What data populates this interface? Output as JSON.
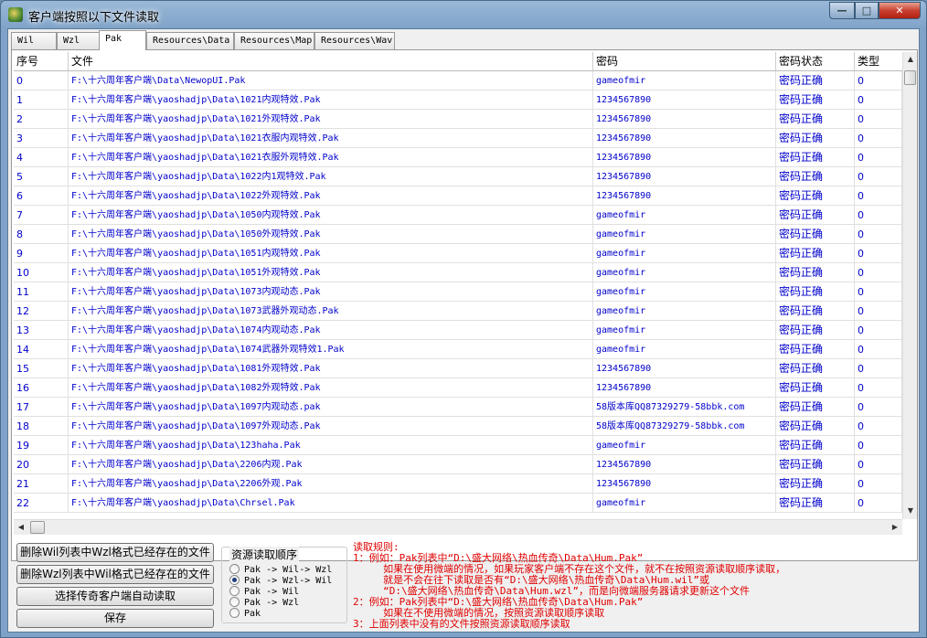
{
  "window": {
    "title": "客户端按照以下文件读取",
    "min": "—",
    "max": "□",
    "close": "✕"
  },
  "tabs": [
    "Wil",
    "Wzl",
    "Pak",
    "Resources\\Data",
    "Resources\\Map",
    "Resources\\Wav"
  ],
  "active_tab": "Pak",
  "columns": [
    "序号",
    "文件",
    "密码",
    "密码状态",
    "类型"
  ],
  "rows": [
    [
      "0",
      "F:\\十六周年客户端\\Data\\NewopUI.Pak",
      "gameofmir",
      "密码正确",
      "0"
    ],
    [
      "1",
      "F:\\十六周年客户端\\yaoshadjp\\Data\\1021内观特效.Pak",
      "1234567890",
      "密码正确",
      "0"
    ],
    [
      "2",
      "F:\\十六周年客户端\\yaoshadjp\\Data\\1021外观特效.Pak",
      "1234567890",
      "密码正确",
      "0"
    ],
    [
      "3",
      "F:\\十六周年客户端\\yaoshadjp\\Data\\1021衣服内观特效.Pak",
      "1234567890",
      "密码正确",
      "0"
    ],
    [
      "4",
      "F:\\十六周年客户端\\yaoshadjp\\Data\\1021衣服外观特效.Pak",
      "1234567890",
      "密码正确",
      "0"
    ],
    [
      "5",
      "F:\\十六周年客户端\\yaoshadjp\\Data\\1022内1观特效.Pak",
      "1234567890",
      "密码正确",
      "0"
    ],
    [
      "6",
      "F:\\十六周年客户端\\yaoshadjp\\Data\\1022外观特效.Pak",
      "1234567890",
      "密码正确",
      "0"
    ],
    [
      "7",
      "F:\\十六周年客户端\\yaoshadjp\\Data\\1050内观特效.Pak",
      "gameofmir",
      "密码正确",
      "0"
    ],
    [
      "8",
      "F:\\十六周年客户端\\yaoshadjp\\Data\\1050外观特效.Pak",
      "gameofmir",
      "密码正确",
      "0"
    ],
    [
      "9",
      "F:\\十六周年客户端\\yaoshadjp\\Data\\1051内观特效.Pak",
      "gameofmir",
      "密码正确",
      "0"
    ],
    [
      "10",
      "F:\\十六周年客户端\\yaoshadjp\\Data\\1051外观特效.Pak",
      "gameofmir",
      "密码正确",
      "0"
    ],
    [
      "11",
      "F:\\十六周年客户端\\yaoshadjp\\Data\\1073内观动态.Pak",
      "gameofmir",
      "密码正确",
      "0"
    ],
    [
      "12",
      "F:\\十六周年客户端\\yaoshadjp\\Data\\1073武器外观动态.Pak",
      "gameofmir",
      "密码正确",
      "0"
    ],
    [
      "13",
      "F:\\十六周年客户端\\yaoshadjp\\Data\\1074内观动态.Pak",
      "gameofmir",
      "密码正确",
      "0"
    ],
    [
      "14",
      "F:\\十六周年客户端\\yaoshadjp\\Data\\1074武器外观特效1.Pak",
      "gameofmir",
      "密码正确",
      "0"
    ],
    [
      "15",
      "F:\\十六周年客户端\\yaoshadjp\\Data\\1081外观特效.Pak",
      "1234567890",
      "密码正确",
      "0"
    ],
    [
      "16",
      "F:\\十六周年客户端\\yaoshadjp\\Data\\1082外观特效.Pak",
      "1234567890",
      "密码正确",
      "0"
    ],
    [
      "17",
      "F:\\十六周年客户端\\yaoshadjp\\Data\\1097内观动态.pak",
      "58版本库QQ87329279-58bbk.com",
      "密码正确",
      "0"
    ],
    [
      "18",
      "F:\\十六周年客户端\\yaoshadjp\\Data\\1097外观动态.Pak",
      "58版本库QQ87329279-58bbk.com",
      "密码正确",
      "0"
    ],
    [
      "19",
      "F:\\十六周年客户端\\yaoshadjp\\Data\\123haha.Pak",
      "gameofmir",
      "密码正确",
      "0"
    ],
    [
      "20",
      "F:\\十六周年客户端\\yaoshadjp\\Data\\2206内观.Pak",
      "1234567890",
      "密码正确",
      "0"
    ],
    [
      "21",
      "F:\\十六周年客户端\\yaoshadjp\\Data\\2206外观.Pak",
      "1234567890",
      "密码正确",
      "0"
    ],
    [
      "22",
      "F:\\十六周年客户端\\yaoshadjp\\Data\\Chrsel.Pak",
      "gameofmir",
      "密码正确",
      "0"
    ]
  ],
  "buttons": {
    "delete_wil": "删除Wil列表中Wzl格式已经存在的文件",
    "delete_wzl": "删除Wzl列表中Wil格式已经存在的文件",
    "auto_read": "选择传奇客户端自动读取",
    "save": "保存"
  },
  "order": {
    "title": "资源读取顺序",
    "options": [
      "Pak -> Wil-> Wzl",
      "Pak -> Wzl-> Wil",
      "Pak -> Wil",
      "Pak -> Wzl",
      "Pak"
    ],
    "selected": 1
  },
  "rules": [
    "读取规则:",
    "1：例如：Pak列表中“D:\\盛大网络\\热血传奇\\Data\\Hum.Pak”",
    "     如果在使用微端的情况，如果玩家客户端不存在这个文件，就不在按照资源读取顺序读取，",
    "     就是不会在往下读取是否有“D:\\盛大网络\\热血传奇\\Data\\Hum.wil”或",
    "     “D:\\盛大网络\\热血传奇\\Data\\Hum.wzl”，而是向微端服务器请求更新这个文件",
    "2：例如：Pak列表中“D:\\盛大网络\\热血传奇\\Data\\Hum.Pak”",
    "     如果在不使用微端的情况，按照资源读取顺序读取",
    "3：上面列表中没有的文件按照资源读取顺序读取"
  ]
}
